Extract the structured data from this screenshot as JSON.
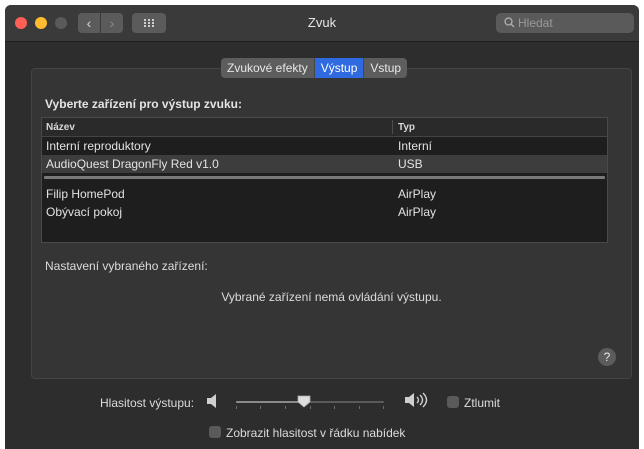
{
  "window": {
    "title": "Zvuk",
    "search_placeholder": "Hledat"
  },
  "tabs": [
    {
      "label": "Zvukové efekty",
      "active": false
    },
    {
      "label": "Výstup",
      "active": true
    },
    {
      "label": "Vstup",
      "active": false
    }
  ],
  "output": {
    "choose_label": "Vyberte zařízení pro výstup zvuku:",
    "columns": {
      "name": "Název",
      "type": "Typ"
    },
    "devices_top": [
      {
        "name": "Interní reproduktory",
        "type": "Interní",
        "selected": false
      },
      {
        "name": "AudioQuest DragonFly Red v1.0",
        "type": "USB",
        "selected": true
      }
    ],
    "devices_bottom": [
      {
        "name": "Filip HomePod",
        "type": "AirPlay"
      },
      {
        "name": "Obývací pokoj",
        "type": "AirPlay"
      }
    ],
    "settings_label": "Nastavení vybraného zařízení:",
    "no_controls_text": "Vybrané zařízení nemá ovládání výstupu.",
    "help_label": "?"
  },
  "volume": {
    "label": "Hlasitost výstupu:",
    "level_fraction": 0.46,
    "mute_label": "Ztlumit",
    "mute_checked": false,
    "show_in_menu_label": "Zobrazit hlasitost v řádku nabídek",
    "show_in_menu_checked": false
  },
  "colors": {
    "accent": "#2f6ae0",
    "close": "#ff5f57",
    "minimize": "#febc2e"
  },
  "icons": {
    "back": "chevron-left-icon",
    "forward": "chevron-right-icon",
    "grid": "grid-icon",
    "search": "search-icon",
    "speaker_low": "speaker-low-icon",
    "speaker_high": "speaker-high-icon"
  }
}
